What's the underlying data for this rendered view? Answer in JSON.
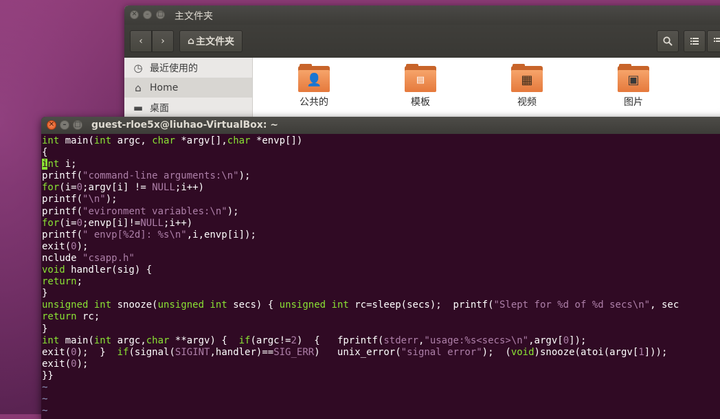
{
  "file_manager": {
    "window_title": "主文件夹",
    "breadcrumb_label": "主文件夹",
    "sidebar": [
      {
        "label": "最近使用的",
        "icon": "clock-icon"
      },
      {
        "label": "Home",
        "icon": "home-icon"
      },
      {
        "label": "桌面",
        "icon": "folder-icon"
      }
    ],
    "folders": [
      {
        "label": "公共的",
        "icon": "person-folder-icon"
      },
      {
        "label": "模板",
        "icon": "template-folder-icon"
      },
      {
        "label": "视频",
        "icon": "video-folder-icon"
      },
      {
        "label": "图片",
        "icon": "pictures-folder-icon"
      }
    ]
  },
  "terminal": {
    "title": "guest-rloe5x@liuhao-VirtualBox: ~",
    "colors": {
      "background": "#300a24",
      "keyword": "#8ae234",
      "string": "#ad7fa8",
      "text": "#ffffff"
    },
    "lines": [
      [
        [
          "kw",
          "int"
        ],
        [
          "t",
          " main("
        ],
        [
          "kw",
          "int"
        ],
        [
          "t",
          " argc, "
        ],
        [
          "kw",
          "char"
        ],
        [
          "t",
          " *argv[],"
        ],
        [
          "kw",
          "char"
        ],
        [
          "t",
          " *envp[])"
        ]
      ],
      [
        [
          "t",
          "{"
        ]
      ],
      [
        [
          "cur",
          "i"
        ],
        [
          "kw",
          "nt"
        ],
        [
          "t",
          " i;"
        ]
      ],
      [
        [
          "t",
          "printf("
        ],
        [
          "str",
          "\"command-line arguments:\\n\""
        ],
        [
          "t",
          ");"
        ]
      ],
      [
        [
          "kw",
          "for"
        ],
        [
          "t",
          "(i="
        ],
        [
          "str",
          "0"
        ],
        [
          "t",
          ";argv[i] != "
        ],
        [
          "str",
          "NULL"
        ],
        [
          "t",
          ";i++)"
        ]
      ],
      [
        [
          "t",
          "printf("
        ],
        [
          "str",
          "\"\\n\""
        ],
        [
          "t",
          ");"
        ]
      ],
      [
        [
          "t",
          "printf("
        ],
        [
          "str",
          "\"evironment variables:\\n\""
        ],
        [
          "t",
          ");"
        ]
      ],
      [
        [
          "kw",
          "for"
        ],
        [
          "t",
          "(i="
        ],
        [
          "str",
          "0"
        ],
        [
          "t",
          ";envp[i]!="
        ],
        [
          "str",
          "NULL"
        ],
        [
          "t",
          ";i++)"
        ]
      ],
      [
        [
          "t",
          "printf("
        ],
        [
          "str",
          "\" envp[%2d]: %s\\n\""
        ],
        [
          "t",
          ",i,envp[i]);"
        ]
      ],
      [
        [
          "t",
          "exit("
        ],
        [
          "str",
          "0"
        ],
        [
          "t",
          ");"
        ]
      ],
      [
        [
          "t",
          "nclude "
        ],
        [
          "str",
          "\"csapp.h\""
        ]
      ],
      [
        [
          "kw",
          "void"
        ],
        [
          "t",
          " handler(sig) {"
        ]
      ],
      [
        [
          "kw",
          "return"
        ],
        [
          "t",
          ";"
        ]
      ],
      [
        [
          "t",
          "}"
        ]
      ],
      [
        [
          "kw",
          "unsigned"
        ],
        [
          "t",
          " "
        ],
        [
          "kw",
          "int"
        ],
        [
          "t",
          " snooze("
        ],
        [
          "kw",
          "unsigned"
        ],
        [
          "t",
          " "
        ],
        [
          "kw",
          "int"
        ],
        [
          "t",
          " secs) { "
        ],
        [
          "kw",
          "unsigned"
        ],
        [
          "t",
          " "
        ],
        [
          "kw",
          "int"
        ],
        [
          "t",
          " rc=sleep(secs);  printf("
        ],
        [
          "str",
          "\"Slept for %d of %d secs\\n\""
        ],
        [
          "t",
          ", sec"
        ]
      ],
      [
        [
          "kw",
          "return"
        ],
        [
          "t",
          " rc;"
        ]
      ],
      [
        [
          "t",
          "}"
        ]
      ],
      [
        [
          "kw",
          "int"
        ],
        [
          "t",
          " main("
        ],
        [
          "kw",
          "int"
        ],
        [
          "t",
          " argc,"
        ],
        [
          "kw",
          "char"
        ],
        [
          "t",
          " **argv) {  "
        ],
        [
          "kw",
          "if"
        ],
        [
          "t",
          "(argc!="
        ],
        [
          "str",
          "2"
        ],
        [
          "t",
          ")  {   fprintf("
        ],
        [
          "str",
          "stderr"
        ],
        [
          "t",
          ","
        ],
        [
          "str",
          "\"usage:%s<secs>\\n\""
        ],
        [
          "t",
          ",argv["
        ],
        [
          "str",
          "0"
        ],
        [
          "t",
          "]);"
        ]
      ],
      [
        [
          "t",
          "exit("
        ],
        [
          "str",
          "0"
        ],
        [
          "t",
          ");  }  "
        ],
        [
          "kw",
          "if"
        ],
        [
          "t",
          "(signal("
        ],
        [
          "str",
          "SIGINT"
        ],
        [
          "t",
          ",handler)=="
        ],
        [
          "str",
          "SIG_ERR"
        ],
        [
          "t",
          ")   unix_error("
        ],
        [
          "str",
          "\"signal error\""
        ],
        [
          "t",
          ");  ("
        ],
        [
          "kw",
          "void"
        ],
        [
          "t",
          ")snooze(atoi(argv["
        ],
        [
          "str",
          "1"
        ],
        [
          "t",
          "]));"
        ]
      ],
      [
        [
          "t",
          "exit("
        ],
        [
          "str",
          "0"
        ],
        [
          "t",
          ");"
        ]
      ],
      [
        [
          "t",
          "}}"
        ]
      ],
      [
        [
          "tilde",
          "~"
        ]
      ],
      [
        [
          "tilde",
          "~"
        ]
      ],
      [
        [
          "tilde",
          "~"
        ]
      ]
    ]
  }
}
